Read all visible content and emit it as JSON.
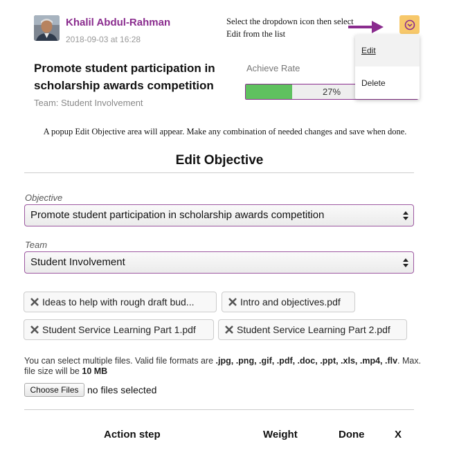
{
  "card": {
    "author": "Khalil Abdul-Rahman",
    "timestamp": "2018-09-03 at 16:28",
    "title": "Promote student participation in scholarship awards competition",
    "team": "Team: Student Involvement",
    "achieve_label": "Achieve Rate",
    "achieve_value": "27%",
    "achieve_fraction": 0.27
  },
  "tutorial": {
    "step1": "Select the dropdown icon then select Edit from the list",
    "step2": "A popup Edit Objective area will appear. Make any combination of needed changes and save when done."
  },
  "menu": {
    "edit": "Edit",
    "delete": "Delete"
  },
  "edit_form": {
    "title": "Edit Objective",
    "objective_label": "Objective",
    "objective_value": "Promote student participation in scholarship awards competition",
    "team_label": "Team",
    "team_value": "Student Involvement",
    "files": [
      "Ideas to help with rough draft bud...",
      "Intro and objectives.pdf",
      "Student Service Learning Part 1.pdf",
      "Student Service Learning Part 2.pdf"
    ],
    "help_prefix": "You can select multiple files. Valid file formats are ",
    "help_formats": ".jpg, .png, .gif, .pdf, .doc, .ppt, .xls, .mp4, .flv",
    "help_mid": ". Max. file size will be ",
    "help_size": "10 MB",
    "choose_label": "Choose Files",
    "no_file": "no files selected",
    "columns": {
      "action": "Action step",
      "weight": "Weight",
      "done": "Done",
      "remove": "X"
    }
  },
  "colors": {
    "accent": "#8a2c8e",
    "progress": "#5fc15f",
    "dropdown": "#f7c86a"
  },
  "icons": {
    "dropdown": "chevron-down-circle-icon",
    "remove": "close-icon",
    "select": "updown-arrows-icon"
  }
}
